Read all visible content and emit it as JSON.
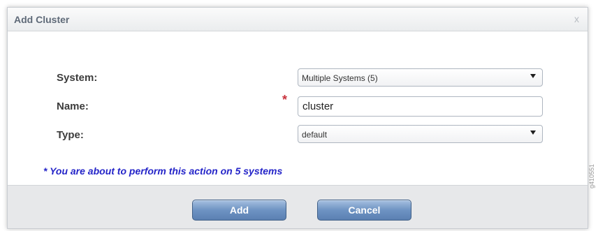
{
  "dialog": {
    "title": "Add Cluster",
    "close_label": "x"
  },
  "form": {
    "system": {
      "label": "System:",
      "value": "Multiple Systems (5)"
    },
    "name": {
      "label": "Name:",
      "value": "cluster",
      "required_mark": "*"
    },
    "type": {
      "label": "Type:",
      "value": "default"
    }
  },
  "note": "* You are about to perform this action on 5 systems",
  "buttons": {
    "add": "Add",
    "cancel": "Cancel"
  },
  "figure_id": "g410551"
}
